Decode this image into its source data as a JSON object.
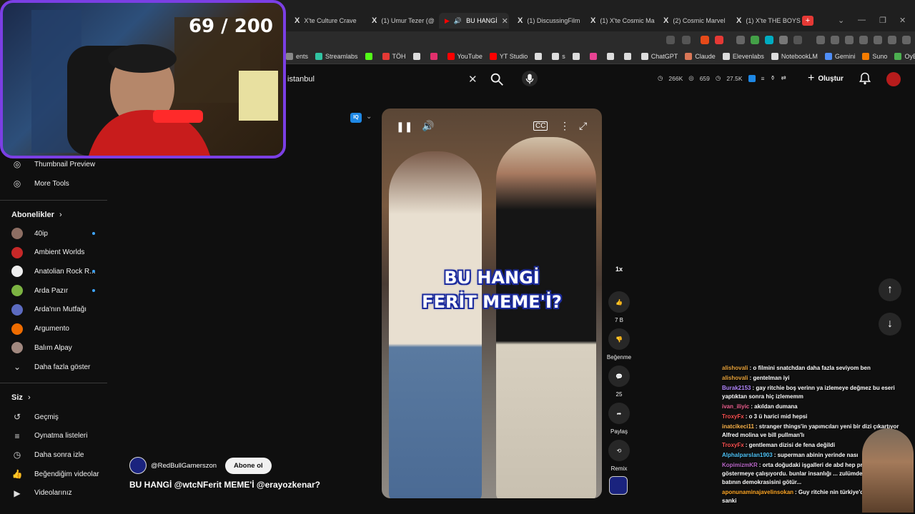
{
  "tabs": [
    {
      "label": "X'te Culture Crave",
      "icon": "x-logo"
    },
    {
      "label": "(1) Umur Tezer (@",
      "icon": "x-logo"
    },
    {
      "label": "BU HANGİ",
      "icon": "youtube-logo",
      "active": true
    },
    {
      "label": "(1) DiscussingFilm",
      "icon": "x-logo"
    },
    {
      "label": "(1) X'te Cosmic Ma",
      "icon": "x-logo"
    },
    {
      "label": "(2) Cosmic Marvel",
      "icon": "x-logo"
    },
    {
      "label": "(1) X'te THE BOYS",
      "icon": "x-logo"
    }
  ],
  "new_tab": "+",
  "bookmarks": [
    {
      "label": "ents",
      "color": "#888888"
    },
    {
      "label": "Streamlabs",
      "color": "#31c3a2"
    },
    {
      "label": "",
      "color": "#53fc18"
    },
    {
      "label": "TÖH",
      "color": "#e53935"
    },
    {
      "label": "",
      "color": "#dddddd"
    },
    {
      "label": "",
      "color": "#e1306c"
    },
    {
      "label": "YouTube",
      "color": "#ff0000"
    },
    {
      "label": "YT Studio",
      "color": "#ff0000"
    },
    {
      "label": "",
      "color": "#dddddd"
    },
    {
      "label": "s",
      "color": "#dddddd"
    },
    {
      "label": "",
      "color": "#dddddd"
    },
    {
      "label": "",
      "color": "#e84393"
    },
    {
      "label": "",
      "color": "#dddddd"
    },
    {
      "label": "",
      "color": "#dddddd"
    },
    {
      "label": "ChatGPT",
      "color": "#dddddd"
    },
    {
      "label": "Claude",
      "color": "#d97757"
    },
    {
      "label": "Elevenlabs",
      "color": "#dddddd"
    },
    {
      "label": "NotebookLM",
      "color": "#dddddd"
    },
    {
      "label": "Gemini",
      "color": "#4f8ef7"
    },
    {
      "label": "Suno",
      "color": "#f57c00"
    },
    {
      "label": "OyEk",
      "color": "#4caf50"
    }
  ],
  "search": {
    "value": "istanbul"
  },
  "stats": {
    "views": "266K",
    "likes": "659",
    "subs": "27.5K"
  },
  "header": {
    "create_label": "Oluştur"
  },
  "webcam": {
    "counter": "69 / 200"
  },
  "sidebar": {
    "tools": [
      {
        "label": "Thumbnail Preview"
      },
      {
        "label": "More Tools"
      }
    ],
    "subscriptions_title": "Abonelikler",
    "subscriptions": [
      {
        "label": "40ip",
        "dot": true,
        "color": "#8d6e63"
      },
      {
        "label": "Ambient Worlds",
        "dot": false,
        "color": "#c62828"
      },
      {
        "label": "Anatolian Rock R...",
        "dot": true,
        "color": "#eeeeee"
      },
      {
        "label": "Arda Pazır",
        "dot": true,
        "color": "#7cb342"
      },
      {
        "label": "Arda'nın Mutfağı",
        "dot": false,
        "color": "#5c6bc0"
      },
      {
        "label": "Argumento",
        "dot": false,
        "color": "#ef6c00"
      },
      {
        "label": "Balım Alpay",
        "dot": false,
        "color": "#a1887f"
      }
    ],
    "show_more": "Daha fazla göster",
    "you_title": "Siz",
    "you_items": [
      {
        "label": "Geçmiş",
        "icon": "history-icon",
        "glyph": "↺"
      },
      {
        "label": "Oynatma listeleri",
        "icon": "playlist-icon",
        "glyph": "≡"
      },
      {
        "label": "Daha sonra izle",
        "icon": "clock-icon",
        "glyph": "◷"
      },
      {
        "label": "Beğendiğim videolar",
        "icon": "thumb-up-icon",
        "glyph": "👍"
      },
      {
        "label": "Videolarınız",
        "icon": "video-icon",
        "glyph": "▶"
      }
    ]
  },
  "short": {
    "caption_line1": "BU HANGİ",
    "caption_line2": "FERİT MEME'İ?",
    "channel": "@RedBullGamerszon",
    "subscribe_label": "Abone ol",
    "title": "BU HANGİ @wtcNFerit MEME'İ @erayozkenar?"
  },
  "actions": {
    "speed": "1x",
    "like_count": "7 B",
    "dislike_label": "Beğenme",
    "comment_count": "25",
    "share_label": "Paylaş",
    "remix_label": "Remix"
  },
  "chat": [
    {
      "user": "alishovali",
      "color": "#e8a33c",
      "text": ": o filmini snatchdan daha fazla seviyom ben"
    },
    {
      "user": "alishovali",
      "color": "#e8a33c",
      "text": ": gentelman iyi"
    },
    {
      "user": "Burak2153",
      "color": "#b388ff",
      "text": ": gay ritchie boş verinn ya izlemeye değmez bu eseri yaptıktan sonra hiç izlememm"
    },
    {
      "user": "ivan_iliyic",
      "color": "#f06292",
      "text": ": akıldan dumana"
    },
    {
      "user": "TroxyFx",
      "color": "#ff5252",
      "text": ": o 3 ü harici mid hepsi"
    },
    {
      "user": "inatcikeci11",
      "color": "#ffb74d",
      "text": ": stranger things'in yapımcıları yeni bir dizi çıkartıyor Alfred molina ve bill pullman'lı"
    },
    {
      "user": "TroxyFx",
      "color": "#ff5252",
      "text": ": gentleman dizisi de fena değildi"
    },
    {
      "user": "Alphalparslan1903",
      "color": "#4fc3f7",
      "text": ": superman abinin yerinde nası"
    },
    {
      "user": "KopimizmKR",
      "color": "#ba68c8",
      "text": ": orta doğudaki işgalleri de abd hep pr... kendilerini haklı göstermeye çalışıyordu. bunlar insanlığı ... zulümden kurtaracağız, batının demokrasisini götür..."
    },
    {
      "user": "aponunaminajavelinsokan",
      "color": "#ffa726",
      "text": ": Guy ritchie nin türkiye'de ... daha vardı sanki"
    }
  ]
}
